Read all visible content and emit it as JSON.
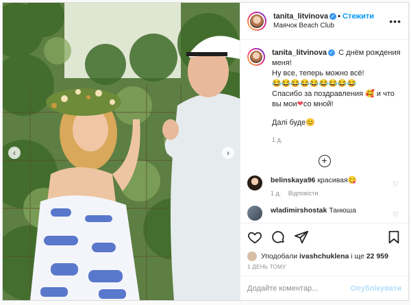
{
  "post": {
    "author": "tanita_litvinova",
    "follow_label": "Стежити",
    "location": "Маячок Beach Club",
    "separator": "•"
  },
  "caption": {
    "author": "tanita_litvinova",
    "line1": "С днём рождения меня!",
    "line2": "Ну все, теперь можно всё!",
    "line3": "😂😂😂😂😂😂😂😂😂",
    "line4a": "Спасибо за поздравления",
    "line4b": "и что вы мои",
    "line4c": "со мной!",
    "line5": "Далі буде😊",
    "time": "1 д."
  },
  "comments": [
    {
      "user": "belinskaya96",
      "text": "красивая😋",
      "time": "1 д.",
      "reply": "Відповісти"
    },
    {
      "user": "wladimirshostak",
      "text": "Танюша"
    }
  ],
  "likes": {
    "prefix": "Уподобали",
    "user": "ivashchuklena",
    "middle": "і ще",
    "count": "22 959"
  },
  "posted_ago": "1 ДЕНЬ ТОМУ",
  "comment_box": {
    "placeholder": "Додайте коментар...",
    "publish_label": "Опублікувати"
  },
  "colors": {
    "accent": "#0095f6",
    "publish_disabled": "#b2dffc",
    "heart": "#ed4956"
  }
}
